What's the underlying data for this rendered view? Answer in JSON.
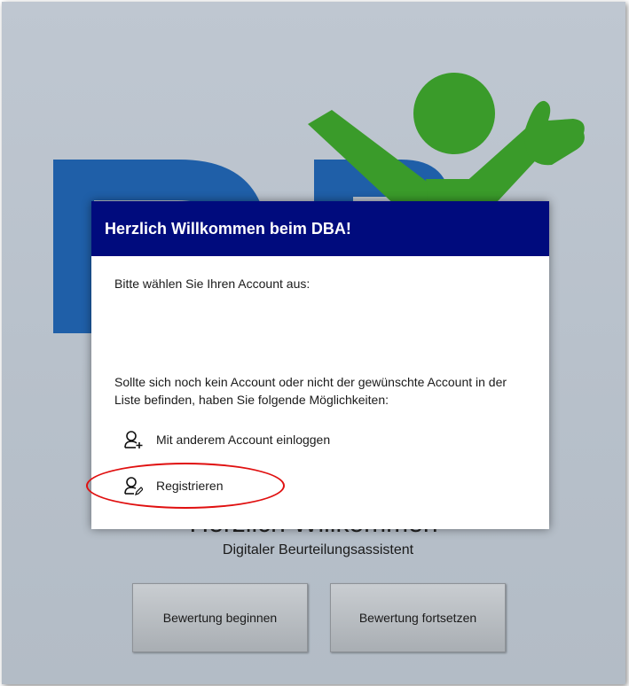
{
  "background": {
    "welcome_title": "Herzlich Willkommen",
    "subtitle": "Digitaler Beurteilungsassistent",
    "buttons": {
      "start": "Bewertung beginnen",
      "continue": "Bewertung fortsetzen"
    }
  },
  "dialog": {
    "title": "Herzlich Willkommen beim DBA!",
    "prompt": "Bitte wählen Sie Ihren Account aus:",
    "info": "Sollte sich noch kein Account oder nicht der gewünschte Account in der Liste befinden, haben Sie folgende Möglichkeiten:",
    "options": [
      {
        "label": "Mit anderem Account einloggen",
        "icon": "add-user-icon"
      },
      {
        "label": "Registrieren",
        "icon": "edit-user-icon"
      }
    ]
  },
  "colors": {
    "header_bg": "#000b7d",
    "logo_blue": "#1f5fa8",
    "logo_green": "#3a9b2a",
    "highlight": "#e01010"
  }
}
